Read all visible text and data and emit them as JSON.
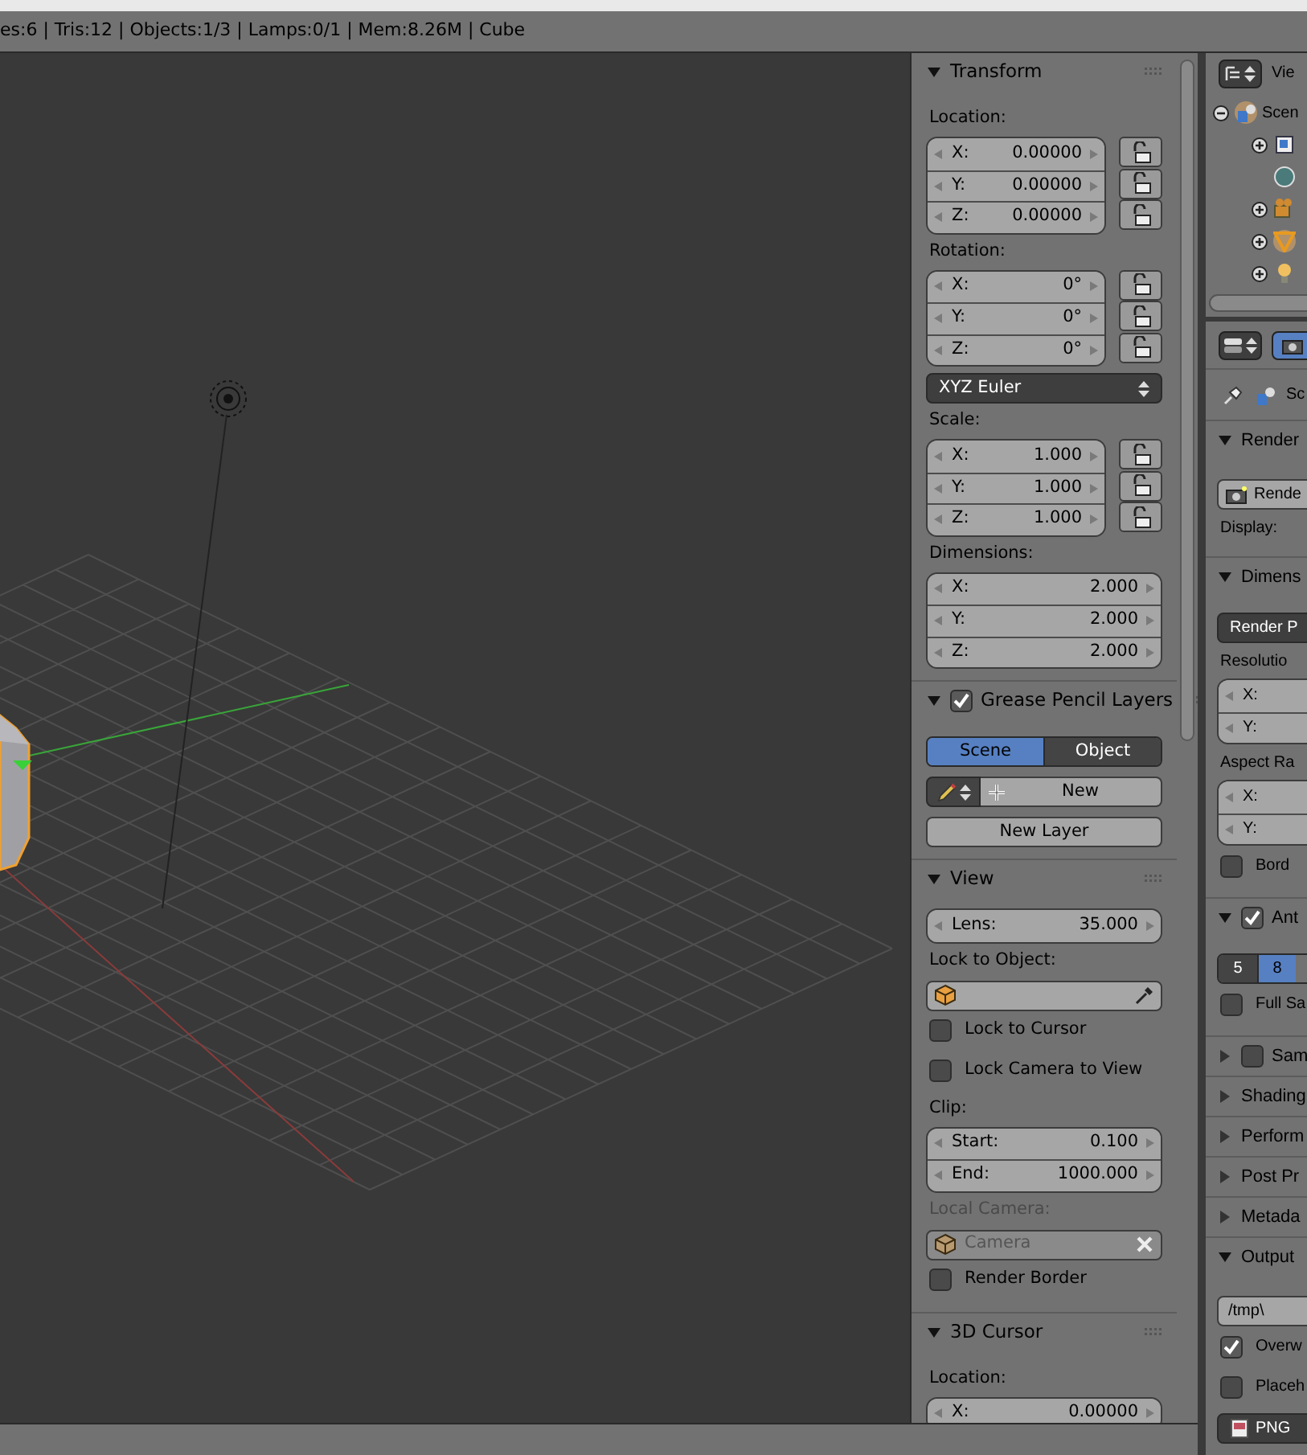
{
  "info_bar": {
    "text": "es:6 | Tris:12 | Objects:1/3 | Lamps:0/1 | Mem:8.26M | Cube"
  },
  "sidebar": {
    "panels": [
      {
        "title": "Transform",
        "expanded": true,
        "items": [
          {
            "kind": "heading",
            "text": "Location:"
          },
          {
            "kind": "vector",
            "fields": [
              {
                "label": "X:",
                "value": "0.00000",
                "locked": false
              },
              {
                "label": "Y:",
                "value": "0.00000",
                "locked": false
              },
              {
                "label": "Z:",
                "value": "0.00000",
                "locked": false
              }
            ]
          },
          {
            "kind": "heading",
            "text": "Rotation:"
          },
          {
            "kind": "vector",
            "fields": [
              {
                "label": "X:",
                "value": "0°",
                "locked": false
              },
              {
                "label": "Y:",
                "value": "0°",
                "locked": false
              },
              {
                "label": "Z:",
                "value": "0°",
                "locked": false
              }
            ]
          },
          {
            "kind": "select",
            "value": "XYZ Euler"
          },
          {
            "kind": "heading",
            "text": "Scale:"
          },
          {
            "kind": "vector",
            "fields": [
              {
                "label": "X:",
                "value": "1.000",
                "locked": false
              },
              {
                "label": "Y:",
                "value": "1.000",
                "locked": false
              },
              {
                "label": "Z:",
                "value": "1.000",
                "locked": false
              }
            ]
          },
          {
            "kind": "heading",
            "text": "Dimensions:"
          },
          {
            "kind": "vector",
            "fields": [
              {
                "label": "X:",
                "value": "2.000"
              },
              {
                "label": "Y:",
                "value": "2.000"
              },
              {
                "label": "Z:",
                "value": "2.000"
              }
            ]
          }
        ]
      },
      {
        "title": "Grease Pencil Layers",
        "expanded": true,
        "checked": true,
        "items": [
          {
            "kind": "segmented",
            "options": [
              {
                "label": "Scene",
                "selected": true
              },
              {
                "label": "Object",
                "selected": false
              }
            ]
          },
          {
            "kind": "new_datablock",
            "label": "New"
          },
          {
            "kind": "button",
            "label": "New Layer"
          }
        ]
      },
      {
        "title": "View",
        "expanded": true,
        "items": [
          {
            "kind": "vector",
            "fields": [
              {
                "label": "Lens:",
                "value": "35.000"
              }
            ]
          },
          {
            "kind": "heading",
            "text": "Lock to Object:"
          },
          {
            "kind": "object_field",
            "disabled": false
          },
          {
            "kind": "checkbox",
            "label": "Lock to Cursor",
            "checked": false
          },
          {
            "kind": "checkbox",
            "label": "Lock Camera to View",
            "checked": false
          },
          {
            "kind": "heading",
            "text": "Clip:"
          },
          {
            "kind": "vector",
            "fields": [
              {
                "label": "Start:",
                "value": "0.100"
              },
              {
                "label": "End:",
                "value": "1000.000"
              }
            ]
          },
          {
            "kind": "heading",
            "text": "Local Camera:",
            "disabled": true
          },
          {
            "kind": "object_field",
            "value": "Camera",
            "disabled": true
          },
          {
            "kind": "checkbox",
            "label": "Render Border",
            "checked": false
          }
        ]
      },
      {
        "title": "3D Cursor",
        "expanded": true,
        "items": [
          {
            "kind": "heading",
            "text": "Location:"
          },
          {
            "kind": "vector",
            "fields": [
              {
                "label": "X:",
                "value": "0.00000"
              }
            ]
          }
        ]
      }
    ]
  },
  "outliner": {
    "view_label": "Vie",
    "tree": [
      {
        "label": "Scen",
        "kind": "scene",
        "expanded": true,
        "selected": true,
        "children": [
          {
            "kind": "renderlayers",
            "expanded": false,
            "selected": false
          },
          {
            "kind": "world",
            "selected": false
          },
          {
            "kind": "camera",
            "expanded": false,
            "selected": false
          },
          {
            "kind": "mesh",
            "expanded": false,
            "selected": true
          },
          {
            "kind": "lamp",
            "expanded": false,
            "selected": false
          }
        ]
      }
    ]
  },
  "properties": {
    "path": "Sc",
    "panels": [
      {
        "title": "Render",
        "expanded": true,
        "items": [
          {
            "kind": "icon_button",
            "label": "Rende"
          },
          {
            "kind": "heading",
            "text": "Display:"
          }
        ]
      },
      {
        "title": "Dimens",
        "expanded": true,
        "items": [
          {
            "kind": "select",
            "value": "Render P"
          },
          {
            "kind": "heading",
            "text": "Resolutio"
          },
          {
            "kind": "vector",
            "fields": [
              {
                "label": "X:"
              },
              {
                "label": "Y:"
              }
            ]
          },
          {
            "kind": "heading",
            "text": "Aspect Ra"
          },
          {
            "kind": "vector",
            "fields": [
              {
                "label": "X:"
              },
              {
                "label": "Y:"
              }
            ]
          },
          {
            "kind": "checkbox",
            "label": "Bord",
            "checked": false
          }
        ]
      },
      {
        "title": "Ant",
        "expanded": true,
        "checked": true,
        "items": [
          {
            "kind": "segmented",
            "options": [
              {
                "label": "5",
                "selected": false
              },
              {
                "label": "8",
                "selected": true
              }
            ]
          },
          {
            "kind": "checkbox",
            "label": "Full Sa",
            "checked": false
          }
        ]
      },
      {
        "title": "Sam",
        "expanded": false,
        "checked": false
      },
      {
        "title": "Shading",
        "expanded": false
      },
      {
        "title": "Perform",
        "expanded": false
      },
      {
        "title": "Post Pr",
        "expanded": false
      },
      {
        "title": "Metada",
        "expanded": false
      },
      {
        "title": "Output",
        "expanded": true,
        "items": [
          {
            "kind": "text_field",
            "value": "/tmp\\"
          },
          {
            "kind": "checkbox",
            "label": "Overw",
            "checked": true
          },
          {
            "kind": "checkbox",
            "label": "Placeh",
            "checked": false
          },
          {
            "kind": "format_select",
            "value": "PNG"
          }
        ]
      }
    ]
  }
}
